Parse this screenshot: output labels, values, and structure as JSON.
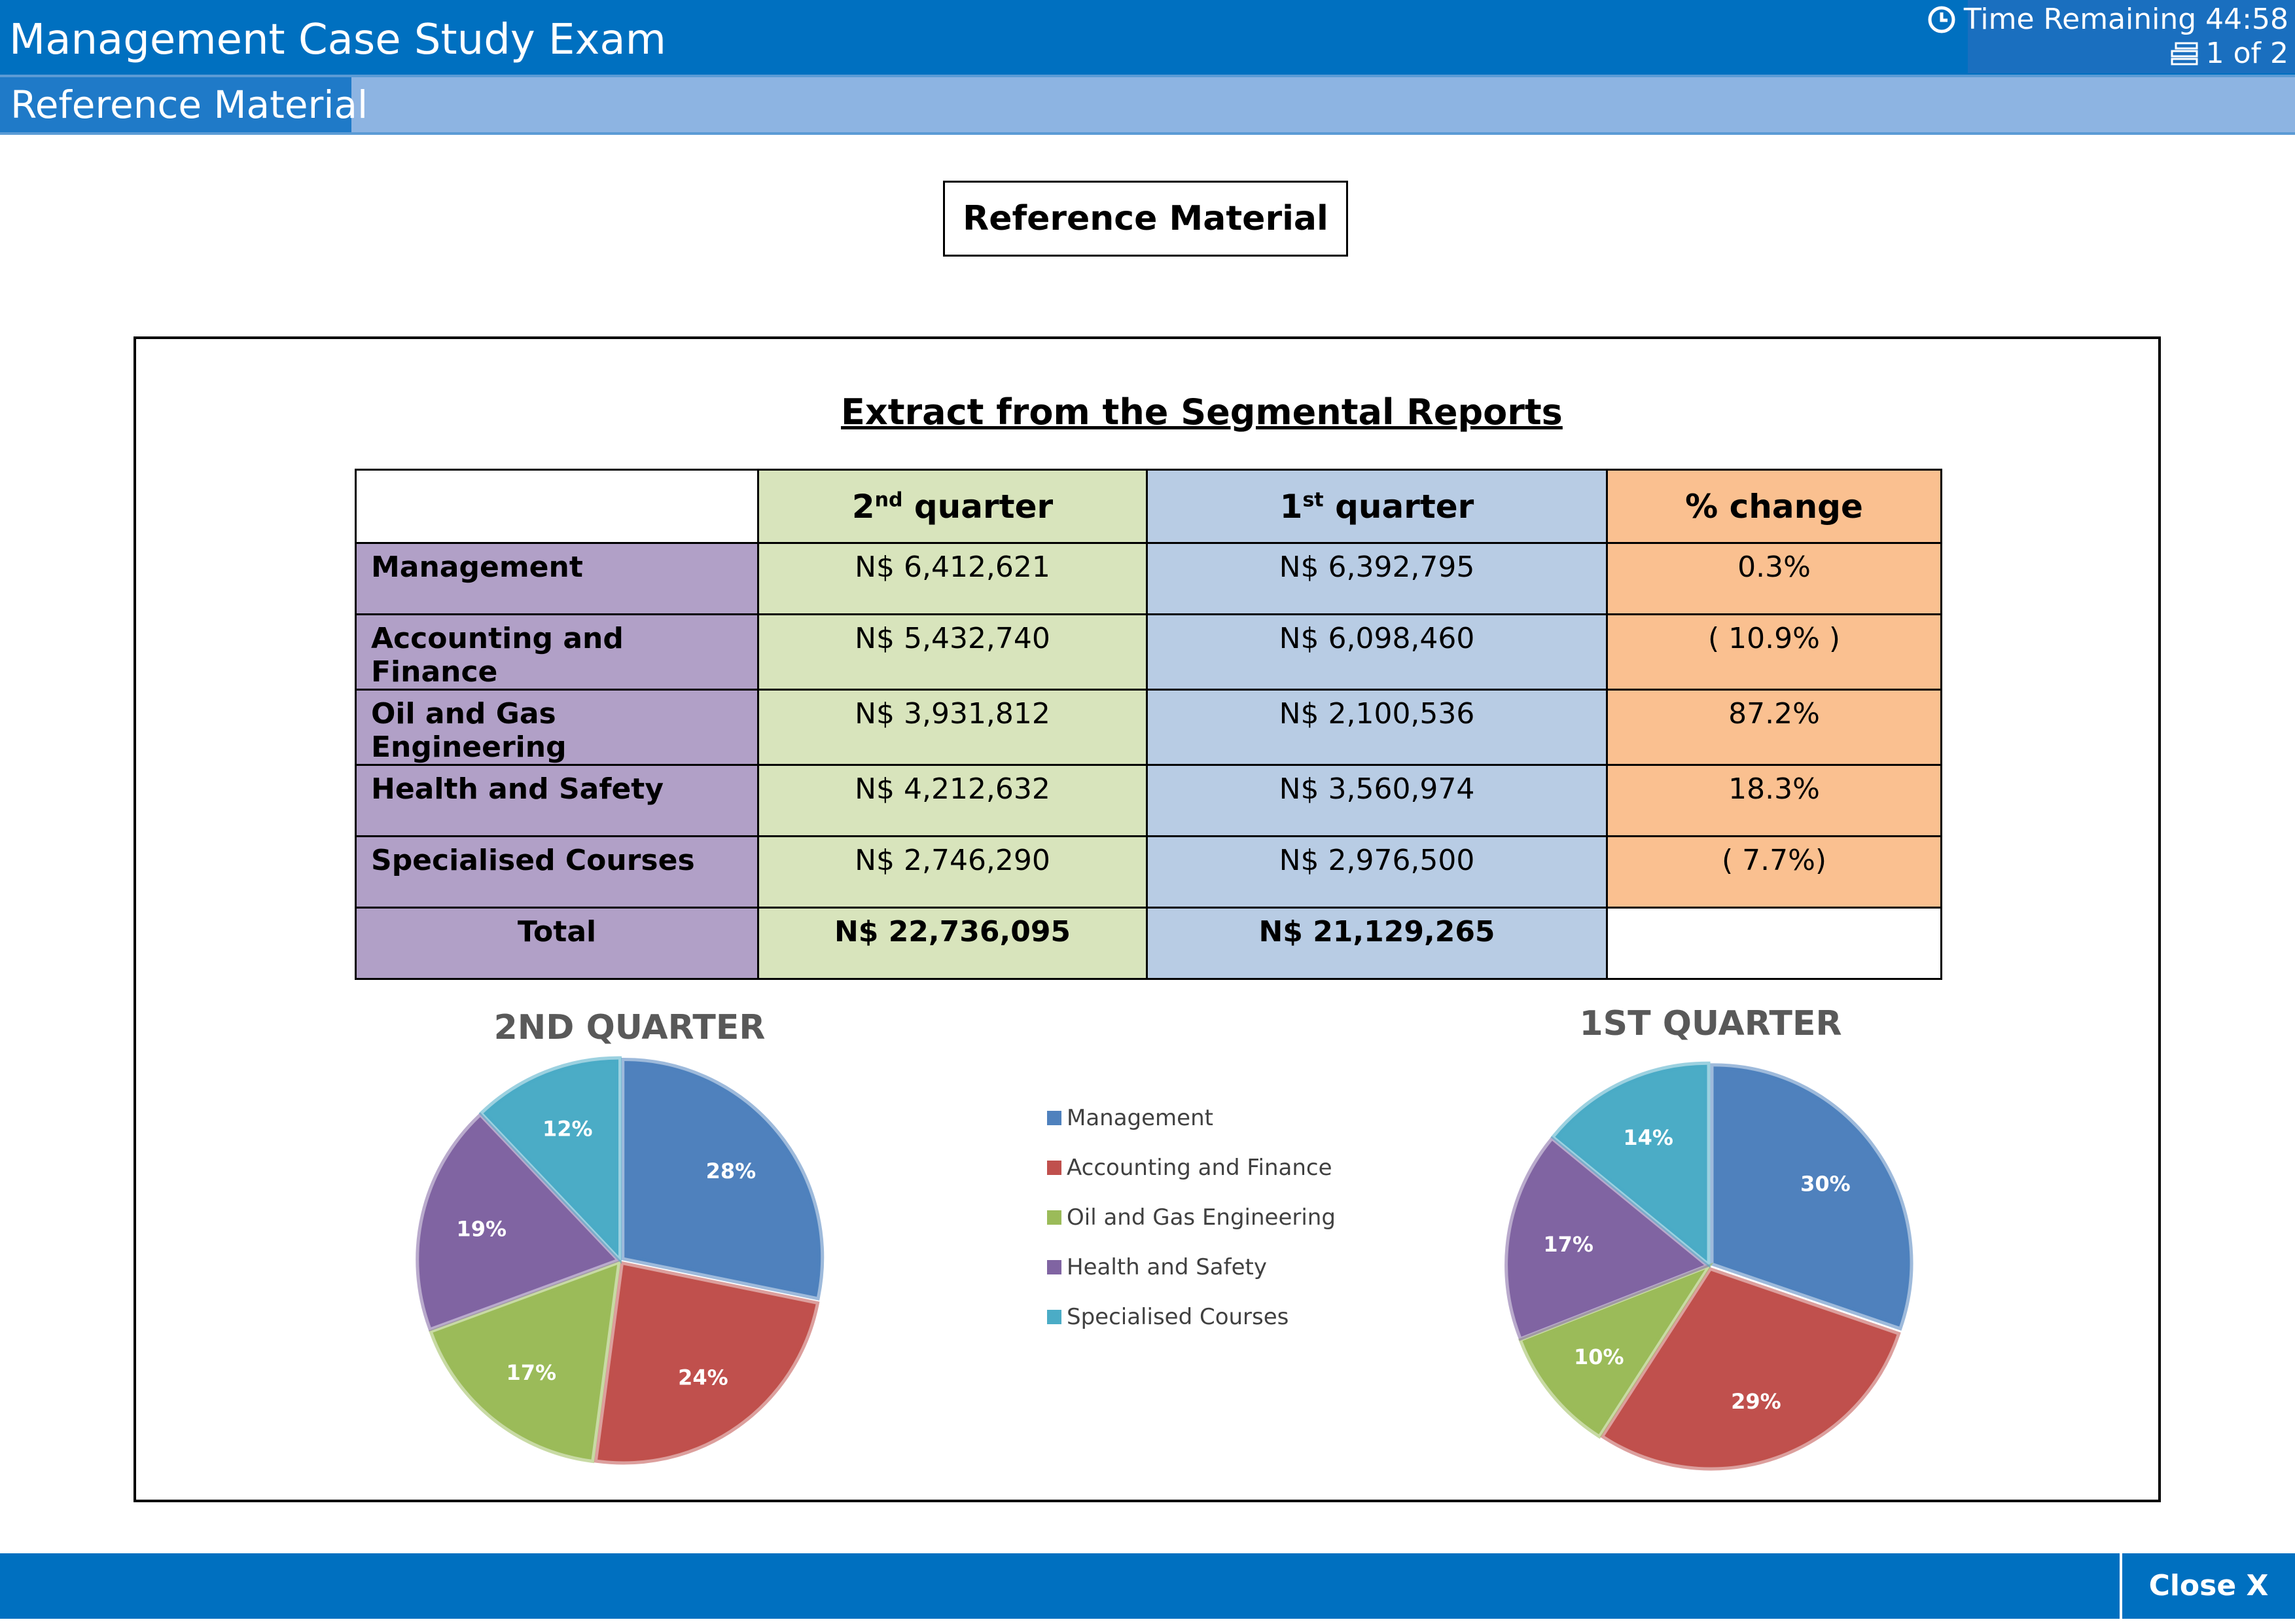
{
  "header": {
    "title": "Management Case Study Exam",
    "timer_label": "Time Remaining 44:58",
    "page_indicator": "1 of 2",
    "active_tab": "Reference Material"
  },
  "main": {
    "heading": "Reference Material",
    "extract_title": "Extract from the Segmental Reports",
    "table": {
      "columns": [
        {
          "main": "2",
          "sup": "nd",
          "rest": " quarter"
        },
        {
          "main": "1",
          "sup": "st",
          "rest": " quarter"
        },
        {
          "main": "% change",
          "sup": "",
          "rest": ""
        }
      ],
      "rows": [
        {
          "label": "Management",
          "q2": "N$ 6,412,621",
          "q1": "N$ 6,392,795",
          "change": "0.3%"
        },
        {
          "label": "Accounting and Finance",
          "q2": "N$ 5,432,740",
          "q1": "N$ 6,098,460",
          "change": "( 10.9% )"
        },
        {
          "label": "Oil and Gas Engineering",
          "q2": "N$ 3,931,812",
          "q1": "N$ 2,100,536",
          "change": "87.2%"
        },
        {
          "label": "Health and Safety",
          "q2": "N$ 4,212,632",
          "q1": "N$ 3,560,974",
          "change": "18.3%"
        },
        {
          "label": "Specialised Courses",
          "q2": "N$ 2,746,290",
          "q1": "N$ 2,976,500",
          "change": "( 7.7%)"
        }
      ],
      "total": {
        "label": "Total",
        "q2": "N$ 22,736,095",
        "q1": "N$ 21,129,265",
        "change": ""
      }
    }
  },
  "colors": {
    "Management": "#4f81bd",
    "Accounting and Finance": "#c0504d",
    "Oil and Gas Engineering": "#9bbb59",
    "Health and Safety": "#8064a2",
    "Specialised Courses": "#4bacc6"
  },
  "chart_data": [
    {
      "type": "pie",
      "title": "2ND QUARTER",
      "categories": [
        "Management",
        "Accounting and Finance",
        "Oil and Gas Engineering",
        "Health and Safety",
        "Specialised Courses"
      ],
      "values": [
        6412621,
        5432740,
        3931812,
        4212632,
        2746290
      ],
      "labels": [
        "28%",
        "24%",
        "17%",
        "19%",
        "12%"
      ],
      "legend": "center"
    },
    {
      "type": "pie",
      "title": "1ST QUARTER",
      "categories": [
        "Management",
        "Accounting and Finance",
        "Oil and Gas Engineering",
        "Health and Safety",
        "Specialised Courses"
      ],
      "values": [
        6392795,
        6098460,
        2100536,
        3560974,
        2976500
      ],
      "labels": [
        "30%",
        "29%",
        "10%",
        "17%",
        "14%"
      ],
      "legend": "center"
    }
  ],
  "footer": {
    "close_label": "Close X"
  }
}
